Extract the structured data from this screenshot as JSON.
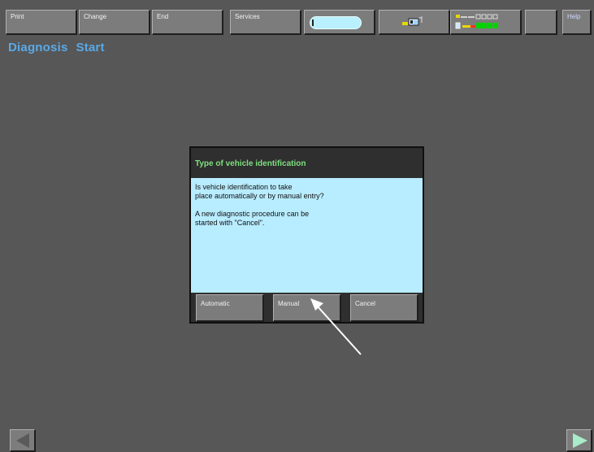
{
  "toolbar": {
    "print_label": "Print",
    "change_label": "Change",
    "end_label": "End",
    "services_label": "Services",
    "help_label": "Help"
  },
  "screen": {
    "title_part1": "Diagnosis",
    "title_part2": "Start"
  },
  "dialog": {
    "title": "Type of vehicle identification",
    "line1": "Is vehicle identification to take",
    "line2": "place automatically or by manual entry?",
    "line3": "A new diagnostic procedure can be",
    "line4": "started with \"Cancel\".",
    "automatic_label": "Automatic",
    "manual_label": "Manual",
    "cancel_label": "Cancel"
  },
  "colors": {
    "background": "#575757",
    "title_blue": "#59a9e8",
    "dialog_title_green": "#7ee07e",
    "dialog_body": "#b8ecff"
  },
  "icons": {
    "slot": "slot-indicator-icon",
    "connection": "connection-status-icon",
    "battery": "battery-status-icon",
    "back": "back-arrow-icon",
    "forward": "forward-arrow-icon",
    "pointer": "pointer-arrow-icon"
  }
}
